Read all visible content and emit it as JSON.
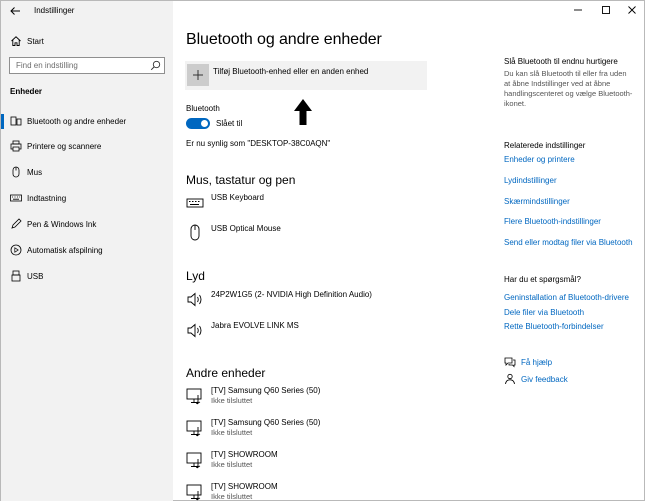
{
  "app": {
    "title": "Indstillinger"
  },
  "sidebar": {
    "home_label": "Start",
    "search_placeholder": "Find en indstilling",
    "section_title": "Enheder",
    "items": [
      {
        "label": "Bluetooth og andre enheder",
        "icon": "bluetooth-devices-icon",
        "active": true
      },
      {
        "label": "Printere og scannere",
        "icon": "printer-icon"
      },
      {
        "label": "Mus",
        "icon": "mouse-icon"
      },
      {
        "label": "Indtastning",
        "icon": "keyboard-icon"
      },
      {
        "label": "Pen & Windows Ink",
        "icon": "pen-icon"
      },
      {
        "label": "Automatisk afspilning",
        "icon": "autoplay-icon"
      },
      {
        "label": "USB",
        "icon": "usb-icon"
      }
    ]
  },
  "main": {
    "title": "Bluetooth og andre enheder",
    "add_device_label": "Tilføj Bluetooth-enhed eller en anden enhed",
    "bluetooth_label": "Bluetooth",
    "toggle_label": "Slået til",
    "visible_as": "Er nu synlig som \"DESKTOP-38C0AQN\"",
    "groups": [
      {
        "title": "Mus, tastatur og pen",
        "devices": [
          {
            "name": "USB Keyboard",
            "icon": "keyboard-icon"
          },
          {
            "name": "USB Optical Mouse",
            "icon": "mouse-icon"
          }
        ]
      },
      {
        "title": "Lyd",
        "devices": [
          {
            "name": "24P2W1G5 (2- NVIDIA High Definition Audio)",
            "icon": "speaker-icon"
          },
          {
            "name": "Jabra EVOLVE LINK MS",
            "icon": "speaker-icon"
          }
        ]
      },
      {
        "title": "Andre enheder",
        "devices": [
          {
            "name": "[TV] Samsung Q60 Series (50)",
            "status": "Ikke tilsluttet",
            "icon": "tv-media-icon"
          },
          {
            "name": "[TV] Samsung Q60 Series (50)",
            "status": "Ikke tilsluttet",
            "icon": "tv-media-icon"
          },
          {
            "name": "[TV] SHOWROOM",
            "status": "Ikke tilsluttet",
            "icon": "tv-media-icon"
          },
          {
            "name": "[TV] SHOWROOM",
            "status": "Ikke tilsluttet",
            "icon": "tv-media-icon"
          }
        ]
      }
    ]
  },
  "right": {
    "quick_title": "Slå Bluetooth til endnu hurtigere",
    "quick_text": "Du kan slå Bluetooth til eller fra uden at åbne Indstillinger ved at åbne handlingscenteret og vælge Bluetooth-ikonet.",
    "related_title": "Relaterede indstillinger",
    "related_links": [
      "Enheder og printere",
      "Lydindstillinger",
      "Skærmindstillinger",
      "Flere Bluetooth-indstillinger",
      "Send eller modtag filer via Bluetooth"
    ],
    "questions_title": "Har du et spørgsmål?",
    "question_links": [
      "Geninstallation af Bluetooth-drivere",
      "Dele filer via Bluetooth",
      "Rette Bluetooth-forbindelser"
    ],
    "help_label": "Få hjælp",
    "feedback_label": "Giv feedback"
  },
  "colors": {
    "accent": "#0067c0",
    "sidebar_bg": "#f2f2f2",
    "button_bg": "#f2f2f2"
  }
}
